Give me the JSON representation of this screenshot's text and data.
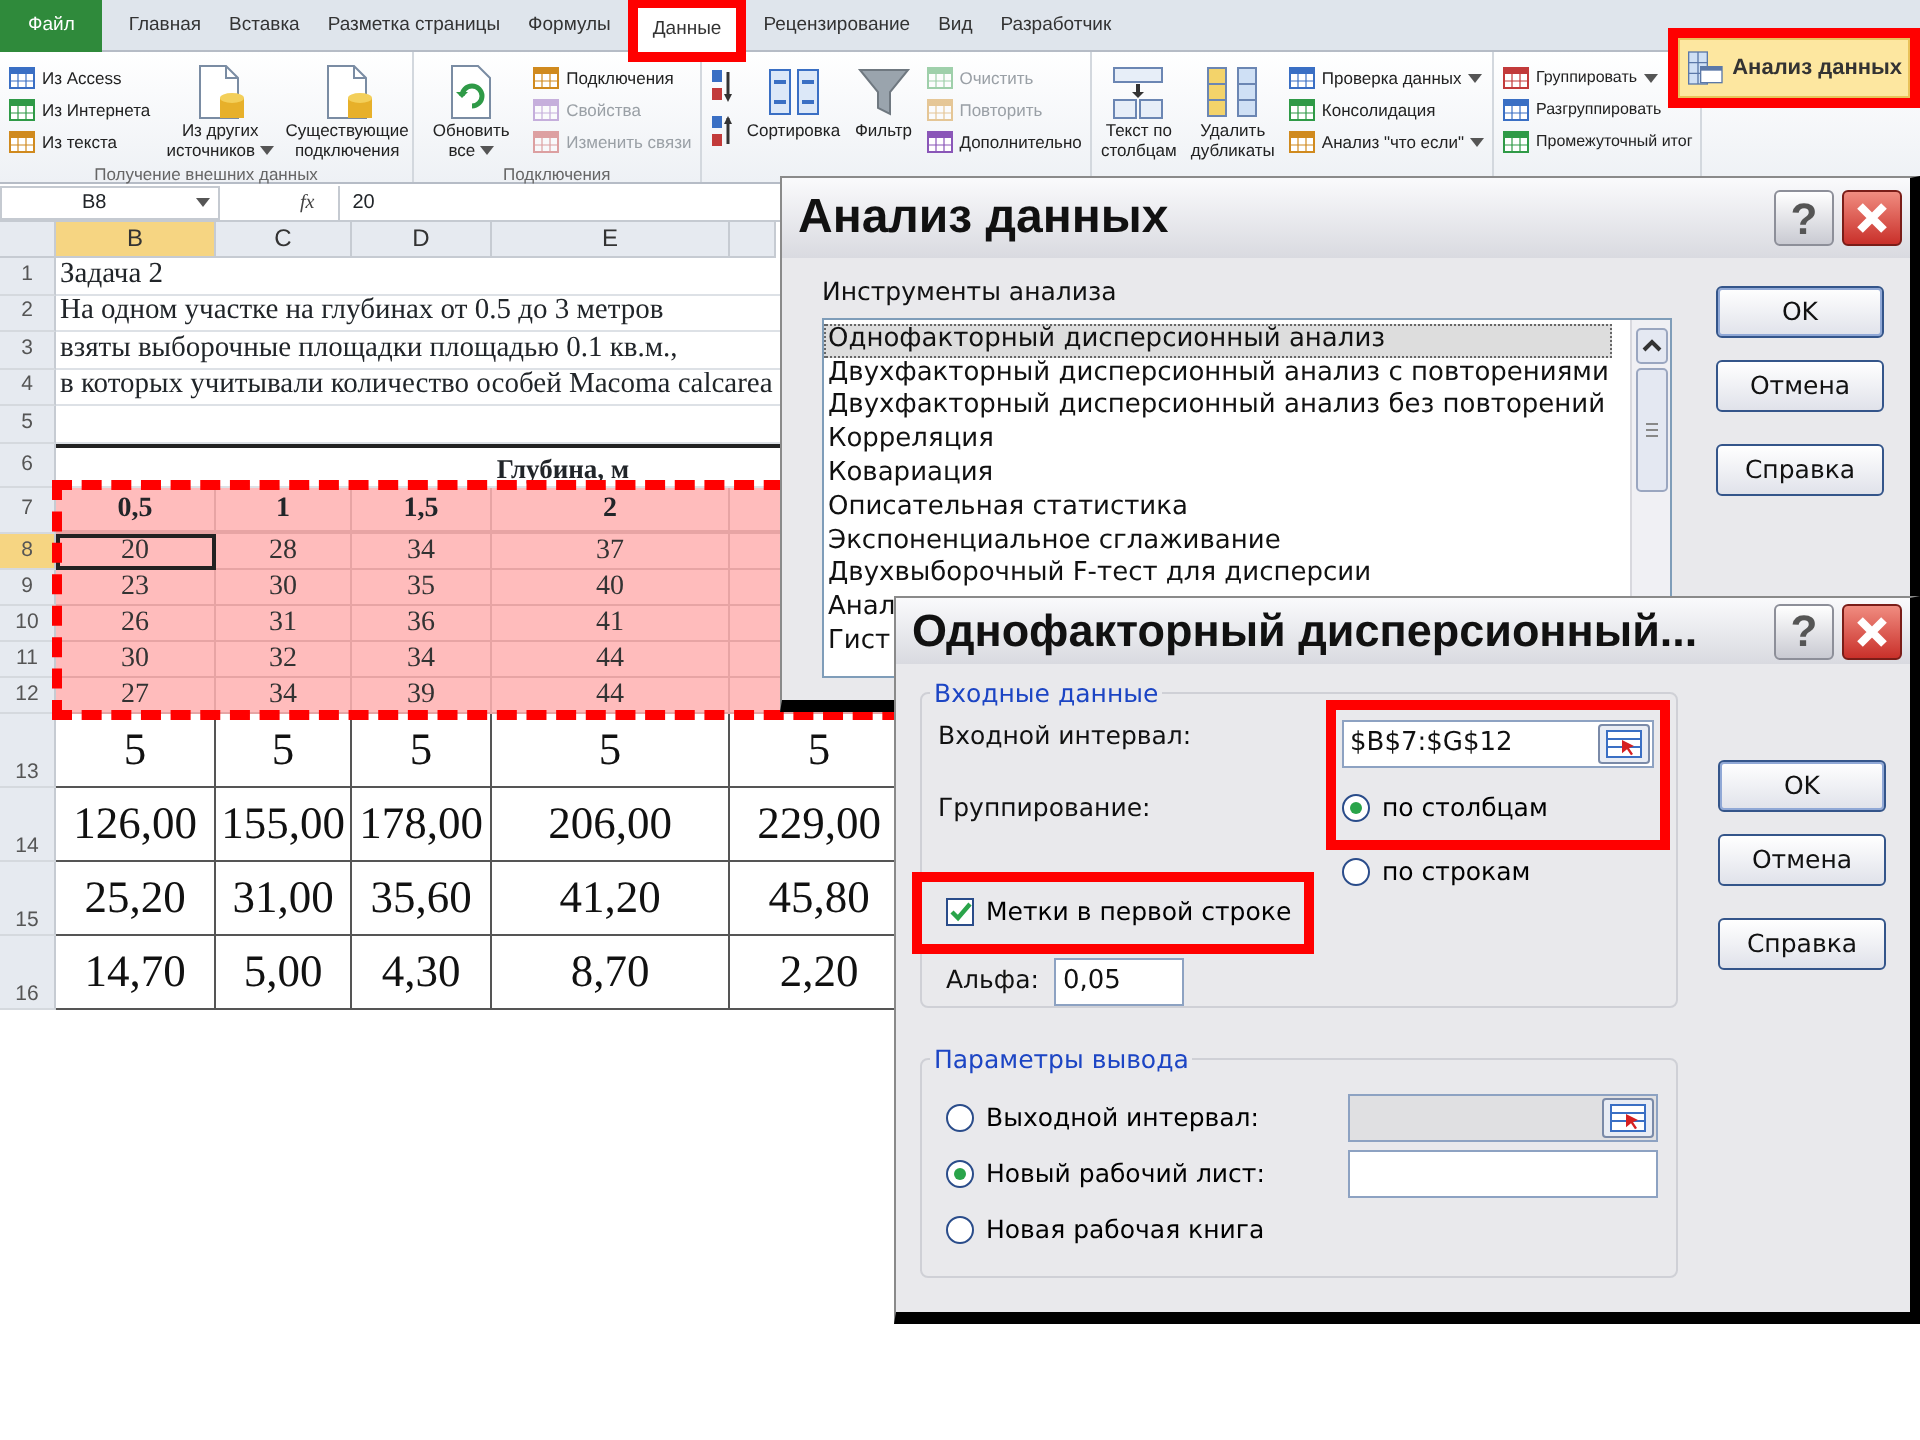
{
  "ribbon": {
    "tabs": [
      {
        "label": "Файл",
        "kind": "file",
        "selected": false,
        "highlighted": false
      },
      {
        "label": "Главная",
        "kind": "tab",
        "selected": false,
        "highlighted": false
      },
      {
        "label": "Вставка",
        "kind": "tab",
        "selected": false,
        "highlighted": false
      },
      {
        "label": "Разметка страницы",
        "kind": "tab",
        "selected": false,
        "highlighted": false
      },
      {
        "label": "Формулы",
        "kind": "tab",
        "selected": false,
        "highlighted": false
      },
      {
        "label": "Данные",
        "kind": "tab",
        "selected": true,
        "highlighted": true
      },
      {
        "label": "Рецензирование",
        "kind": "tab",
        "selected": false,
        "highlighted": false
      },
      {
        "label": "Вид",
        "kind": "tab",
        "selected": false,
        "highlighted": false
      },
      {
        "label": "Разработчик",
        "kind": "tab",
        "selected": false,
        "highlighted": false
      }
    ],
    "groups": [
      {
        "label": "Получение внешних данных",
        "items": [
          {
            "label": "Из Access",
            "kind": "small",
            "disabled": false,
            "dropdown": false,
            "highlighted": false
          },
          {
            "label": "Из Интернета",
            "kind": "small",
            "disabled": false,
            "dropdown": false,
            "highlighted": false
          },
          {
            "label": "Из текста",
            "kind": "small",
            "disabled": false,
            "dropdown": false,
            "highlighted": false
          },
          {
            "label": "Из других источников",
            "kind": "large",
            "disabled": false,
            "dropdown": true,
            "highlighted": false
          },
          {
            "label": "Существующие подключения",
            "kind": "large",
            "disabled": false,
            "dropdown": false,
            "highlighted": false
          }
        ]
      },
      {
        "label": "Подключения",
        "items": [
          {
            "label": "Обновить все",
            "kind": "large",
            "disabled": false,
            "dropdown": true,
            "highlighted": false
          },
          {
            "label": "Подключения",
            "kind": "small",
            "disabled": false,
            "dropdown": false,
            "highlighted": false
          },
          {
            "label": "Свойства",
            "kind": "small",
            "disabled": true,
            "dropdown": false,
            "highlighted": false
          },
          {
            "label": "Изменить связи",
            "kind": "small",
            "disabled": true,
            "dropdown": false,
            "highlighted": false
          }
        ]
      },
      {
        "items": [
          {
            "kind": "icon",
            "disabled": false,
            "dropdown": false,
            "highlighted": false
          },
          {
            "kind": "icon",
            "disabled": false,
            "dropdown": false,
            "highlighted": false
          },
          {
            "label": "Сортировка",
            "kind": "large",
            "disabled": false,
            "dropdown": false,
            "highlighted": false
          },
          {
            "label": "Фильтр",
            "kind": "large",
            "disabled": false,
            "dropdown": false,
            "highlighted": false
          },
          {
            "label": "Очистить",
            "kind": "small",
            "disabled": true,
            "dropdown": false,
            "highlighted": false
          },
          {
            "label": "Повторить",
            "kind": "small",
            "disabled": true,
            "dropdown": false,
            "highlighted": false
          },
          {
            "label": "Дополнительно",
            "kind": "small",
            "disabled": false,
            "dropdown": false,
            "highlighted": false
          }
        ]
      },
      {
        "items": [
          {
            "label": "Текст по столбцам",
            "kind": "large",
            "disabled": false,
            "dropdown": false,
            "highlighted": false
          },
          {
            "label": "Удалить дубликаты",
            "kind": "large",
            "disabled": false,
            "dropdown": false,
            "highlighted": false
          },
          {
            "label": "Проверка данных",
            "kind": "small",
            "disabled": false,
            "dropdown": true,
            "highlighted": false
          },
          {
            "label": "Консолидация",
            "kind": "small",
            "disabled": false,
            "dropdown": false,
            "highlighted": false
          },
          {
            "label": "Анализ \"что если\"",
            "kind": "small",
            "disabled": false,
            "dropdown": true,
            "highlighted": false
          }
        ]
      },
      {
        "items": [
          {
            "label": "Группировать",
            "kind": "small",
            "disabled": false,
            "dropdown": true,
            "highlighted": false
          },
          {
            "label": "Разгруппировать",
            "kind": "small",
            "disabled": false,
            "dropdown": false,
            "highlighted": false
          },
          {
            "label": "Промежуточный итог",
            "kind": "small",
            "disabled": false,
            "dropdown": false,
            "highlighted": false
          }
        ]
      },
      {
        "items": [
          {
            "label": "Анализ данных",
            "kind": "wide",
            "disabled": false,
            "dropdown": false,
            "highlighted": true
          }
        ]
      }
    ]
  },
  "formula_bar": {
    "name_box": "B8",
    "function_label": "fx",
    "value": "20"
  },
  "sheet": {
    "columns": [
      {
        "label": "B",
        "selected": true
      },
      {
        "label": "C",
        "selected": false
      },
      {
        "label": "D",
        "selected": false
      },
      {
        "label": "E",
        "selected": false
      },
      {
        "selected": false
      }
    ],
    "rows": [
      {
        "number": "1",
        "kind": "text",
        "text": "Задача 2",
        "selected": false,
        "highlighted": false
      },
      {
        "number": "2",
        "kind": "text",
        "text": "На одном участке на глубинах от 0.5 до 3 метров",
        "selected": false,
        "highlighted": false
      },
      {
        "number": "3",
        "kind": "text",
        "text": "взяты выборочные площадки площадью 0.1 кв.м.,",
        "selected": false,
        "highlighted": false
      },
      {
        "number": "4",
        "kind": "text",
        "text": "в которых учитывали количество особей Macoma calcarea",
        "selected": false,
        "highlighted": false
      },
      {
        "number": "5",
        "kind": "empty",
        "selected": false,
        "highlighted": false
      },
      {
        "number": "6",
        "kind": "title",
        "text": "Глубина, м",
        "selected": false,
        "highlighted": false
      },
      {
        "number": "7",
        "kind": "header",
        "cells": [
          "0,5",
          "1",
          "1,5",
          "2"
        ],
        "selected": false,
        "highlighted": true
      },
      {
        "number": "8",
        "kind": "data",
        "cells": [
          "20",
          "28",
          "34",
          "37"
        ],
        "selected": true,
        "highlighted": true
      },
      {
        "number": "9",
        "kind": "data",
        "cells": [
          "23",
          "30",
          "35",
          "40"
        ],
        "selected": false,
        "highlighted": true
      },
      {
        "number": "10",
        "kind": "data",
        "cells": [
          "26",
          "31",
          "36",
          "41"
        ],
        "selected": false,
        "highlighted": true
      },
      {
        "number": "11",
        "kind": "data",
        "cells": [
          "30",
          "32",
          "34",
          "44"
        ],
        "selected": false,
        "highlighted": true
      },
      {
        "number": "12",
        "kind": "data",
        "cells": [
          "27",
          "34",
          "39",
          "44"
        ],
        "selected": false,
        "highlighted": true
      },
      {
        "number": "13",
        "kind": "result",
        "cells": [
          "5",
          "5",
          "5",
          "5",
          "5"
        ],
        "selected": false,
        "highlighted": false
      },
      {
        "number": "14",
        "kind": "result",
        "cells": [
          "126,00",
          "155,00",
          "178,00",
          "206,00",
          "229,00"
        ],
        "selected": false,
        "highlighted": false
      },
      {
        "number": "15",
        "kind": "result",
        "cells": [
          "25,20",
          "31,00",
          "35,60",
          "41,20",
          "45,80"
        ],
        "selected": false,
        "highlighted": false
      },
      {
        "number": "16",
        "kind": "result",
        "cells": [
          "14,70",
          "5,00",
          "4,30",
          "8,70",
          "2,20"
        ],
        "selected": false,
        "highlighted": false
      }
    ]
  },
  "analysis_dialog": {
    "title": "Анализ данных",
    "help": "?",
    "tools_label": "Инструменты анализа",
    "tools": [
      {
        "label": "Однофакторный дисперсионный анализ",
        "selected": true
      },
      {
        "label": "Двухфакторный дисперсионный анализ с повторениями",
        "selected": false
      },
      {
        "label": "Двухфакторный дисперсионный анализ без повторений",
        "selected": false
      },
      {
        "label": "Корреляция",
        "selected": false
      },
      {
        "label": "Ковариация",
        "selected": false
      },
      {
        "label": "Описательная статистика",
        "selected": false
      },
      {
        "label": "Экспоненциальное сглаживание",
        "selected": false
      },
      {
        "label": "Двухвыборочный F-тест для дисперсии",
        "selected": false
      },
      {
        "label": "Анал",
        "selected": false
      },
      {
        "label": "Гист",
        "selected": false
      }
    ],
    "buttons": [
      {
        "label": "OK",
        "default": true
      },
      {
        "label": "Отмена",
        "default": false
      },
      {
        "label": "Справка",
        "default": false
      }
    ]
  },
  "anova_dialog": {
    "title": "Однофакторный дисперсионный...",
    "help": "?",
    "input_group": {
      "legend": "Входные данные",
      "range_label": "Входной интервал:",
      "range_value": "$B$7:$G$12",
      "grouping_label": "Группирование:",
      "range_highlighted": true,
      "grouping": [
        {
          "label": "по столбцам",
          "selected": true
        },
        {
          "label": "по строкам",
          "selected": false
        }
      ],
      "labels_checkbox": {
        "label": "Метки в первой строке",
        "checked": true,
        "highlighted": true
      },
      "alpha_label": "Альфа:",
      "alpha_value": "0,05"
    },
    "output_group": {
      "legend": "Параметры вывода",
      "options": [
        {
          "label": "Выходной интервал:",
          "kind": "range",
          "selected": false
        },
        {
          "label": "Новый рабочий лист:",
          "kind": "field",
          "selected": true
        },
        {
          "label": "Новая рабочая книга",
          "kind": "none",
          "selected": false
        }
      ]
    },
    "buttons": [
      {
        "label": "OK",
        "default": true
      },
      {
        "label": "Отмена",
        "default": false
      },
      {
        "label": "Справка",
        "default": false
      }
    ]
  }
}
